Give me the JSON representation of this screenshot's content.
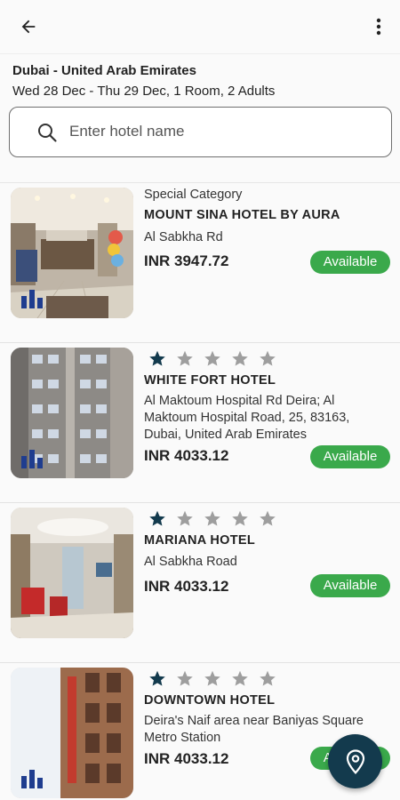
{
  "appbar": {
    "back_icon": "arrow-left-icon",
    "menu_icon": "more-vert-icon"
  },
  "header": {
    "destination": "Dubai - United Arab Emirates",
    "dates": "Wed 28 Dec - Thu 29 Dec, 1 Room, 2 Adults"
  },
  "search": {
    "placeholder": "Enter hotel name",
    "value": ""
  },
  "hotels": [
    {
      "category": "Special Category",
      "name": "MOUNT SINA HOTEL BY AURA",
      "address": "Al Sabkha Rd",
      "price": "INR 3947.72",
      "status": "Available"
    },
    {
      "rating": 1,
      "max_rating": 5,
      "name": "WHITE FORT HOTEL",
      "address": "Al Maktoum Hospital Rd Deira; Al Maktoum Hospital Road, 25, 83163, Dubai, United Arab Emirates",
      "price": "INR 4033.12",
      "status": "Available"
    },
    {
      "rating": 1,
      "max_rating": 5,
      "name": "MARIANA HOTEL",
      "address": "Al Sabkha Road",
      "price": "INR 4033.12",
      "status": "Available"
    },
    {
      "rating": 1,
      "max_rating": 5,
      "name": "DOWNTOWN HOTEL",
      "address": "Deira's Naif area near Baniyas Square Metro Station",
      "price": "INR 4033.12",
      "status": "Available"
    }
  ],
  "fab": {
    "icon": "map-pin-icon"
  },
  "colors": {
    "available_green": "#3aa94b",
    "star_filled": "#133a4d",
    "star_empty": "#9e9e9e",
    "fab_bg": "#133a4d"
  }
}
